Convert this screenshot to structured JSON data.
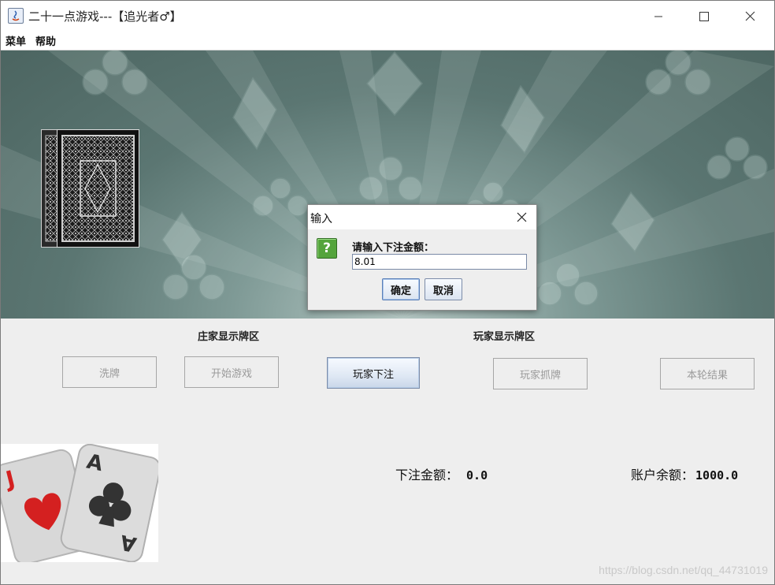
{
  "window": {
    "title": "二十一点游戏---【追光者♂】",
    "controls": [
      "minimize-icon",
      "maximize-icon",
      "close-icon"
    ]
  },
  "menubar": {
    "items": [
      "菜单",
      "帮助"
    ]
  },
  "dialog": {
    "title": "输入",
    "prompt": "请输入下注金额：",
    "input_value": "8.01",
    "ok_label": "确定",
    "cancel_label": "取消",
    "icon": "question-icon"
  },
  "zones": {
    "dealer": "庄家显示牌区",
    "player": "玩家显示牌区"
  },
  "buttons": {
    "shuffle": "洗牌",
    "start": "开始游戏",
    "bet": "玩家下注",
    "draw": "玩家抓牌",
    "result": "本轮结果"
  },
  "status": {
    "bet_label": "下注金额：",
    "bet_value": "0.0",
    "balance_label": "账户余额：",
    "balance_value": "1000.0"
  },
  "logo_cards": {
    "back": "J",
    "front": "A"
  },
  "watermark": "https://blog.csdn.net/qq_44731019",
  "colors": {
    "accent": "#5a7fb8",
    "dialog_icon": "#54a43c",
    "suit_red": "#d42020"
  }
}
